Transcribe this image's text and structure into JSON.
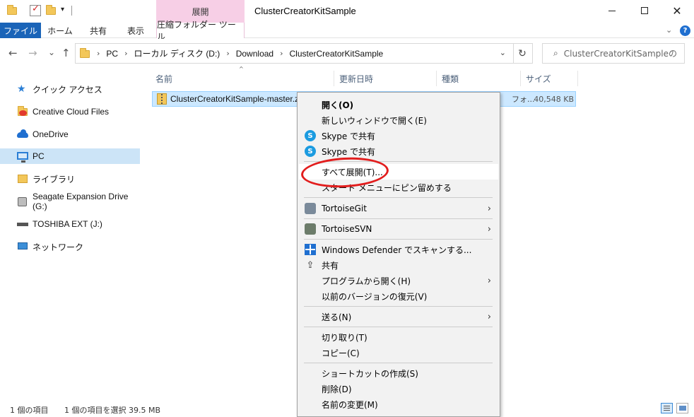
{
  "titlebar": {
    "manage_tab": "展開",
    "window_title": "ClusterCreatorKitSample",
    "quick_access_dropdown": "▾"
  },
  "ribbon": {
    "tabs": [
      "ファイル",
      "ホーム",
      "共有",
      "表示",
      "圧縮フォルダー ツール"
    ],
    "help": "?"
  },
  "navigation": {
    "back": "←",
    "forward": "→",
    "recent": "⌄",
    "up": "↑"
  },
  "address": {
    "breadcrumbs": [
      "PC",
      "ローカル ディスク (D:)",
      "Download",
      "ClusterCreatorKitSample"
    ],
    "separator": "›",
    "dropdown": "⌄",
    "refresh": "↻"
  },
  "search": {
    "placeholder": "ClusterCreatorKitSampleの検索",
    "icon": "⌕"
  },
  "sidebar": {
    "items": [
      {
        "label": "クイック アクセス",
        "icon": "star-icon"
      },
      {
        "label": "Creative Cloud Files",
        "icon": "creative-cloud-icon"
      },
      {
        "label": "OneDrive",
        "icon": "cloud-icon"
      },
      {
        "label": "PC",
        "icon": "pc-icon",
        "selected": true
      },
      {
        "label": "ライブラリ",
        "icon": "library-icon"
      },
      {
        "label": "Seagate Expansion Drive (G:)",
        "icon": "drive-icon"
      },
      {
        "label": "TOSHIBA EXT (J:)",
        "icon": "usb-drive-icon"
      },
      {
        "label": "ネットワーク",
        "icon": "network-icon"
      }
    ]
  },
  "columns": {
    "name": "名前",
    "date": "更新日時",
    "type": "種類",
    "size": "サイズ",
    "sort_indicator": "^"
  },
  "files": [
    {
      "name": "ClusterCreatorKitSample-master.zip",
      "type_fragment": "フォ...",
      "size": "40,548 KB"
    }
  ],
  "status": {
    "item_count": "1 個の項目",
    "selection": "1 個の項目を選択  39.5 MB"
  },
  "context_menu": {
    "items": [
      {
        "label": "開く(O)",
        "bold": true
      },
      {
        "label": "新しいウィンドウで開く(E)"
      },
      {
        "label": "Skype で共有",
        "icon": "skype-icon"
      },
      {
        "label": "Skype で共有",
        "icon": "skype-icon"
      },
      {
        "label": "すべて展開(T)...",
        "highlighted": true
      },
      {
        "label": "スタート メニューにピン留めする"
      },
      {
        "label": "TortoiseGit",
        "icon": "tortoisegit-icon",
        "submenu": true
      },
      {
        "label": "TortoiseSVN",
        "icon": "tortoisesvn-icon",
        "submenu": true
      },
      {
        "label": "Windows Defender でスキャンする...",
        "icon": "defender-icon"
      },
      {
        "label": "共有",
        "icon": "share-icon"
      },
      {
        "label": "プログラムから開く(H)",
        "submenu": true
      },
      {
        "label": "以前のバージョンの復元(V)"
      },
      {
        "label": "送る(N)",
        "submenu": true
      },
      {
        "label": "切り取り(T)"
      },
      {
        "label": "コピー(C)"
      },
      {
        "label": "ショートカットの作成(S)"
      },
      {
        "label": "削除(D)"
      },
      {
        "label": "名前の変更(M)"
      }
    ],
    "submenu_arrow": "›",
    "skype_glyph": "S"
  },
  "colors": {
    "file_tab": "#1a64b8",
    "manage_tab": "#f7cfe6",
    "selection": "#cce8ff",
    "annotation": "#e21d1d"
  }
}
